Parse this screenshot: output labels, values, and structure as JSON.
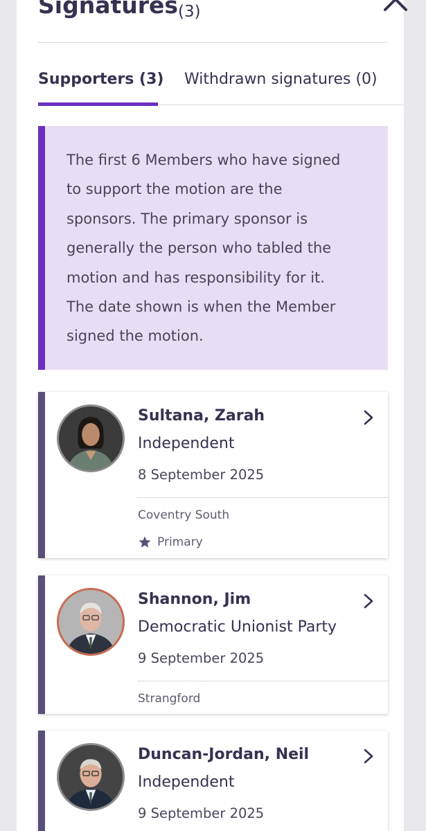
{
  "section": {
    "title": "Signatures",
    "count": "(3)"
  },
  "tabs": [
    {
      "label": "Supporters (3)",
      "active": true
    },
    {
      "label": "Withdrawn signatures (0)",
      "active": false
    }
  ],
  "info": {
    "lines": [
      "The first 6 Members who have signed",
      "to support the motion are the",
      "sponsors. The primary sponsor is",
      "generally the person who tabled the",
      "motion and has responsibility for it.",
      "The date shown is when the Member",
      "signed the motion."
    ]
  },
  "members": [
    {
      "name": "Sultana, Zarah",
      "party": "Independent",
      "date": "8 September 2025",
      "constituency": "Coventry South",
      "role": "Primary",
      "party_color": "#8c8c8c"
    },
    {
      "name": "Shannon, Jim",
      "party": "Democratic Unionist Party",
      "date": "9 September 2025",
      "constituency": "Strangford",
      "party_color": "#c96a50"
    },
    {
      "name": "Duncan-Jordan, Neil",
      "party": "Independent",
      "date": "9 September 2025",
      "party_color": "#8c8c8c"
    }
  ],
  "icons": {
    "collapse": "chevron-up-icon",
    "card_link": "chevron-right-icon",
    "primary": "star-icon"
  },
  "colors": {
    "accent": "#6a2fbf",
    "text": "#373151",
    "info_bg": "#e8def3",
    "card_border": "#5a4f78"
  }
}
